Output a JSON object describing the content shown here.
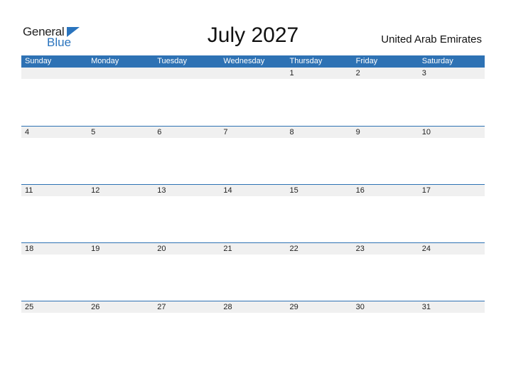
{
  "logo": {
    "general": "General",
    "blue": "Blue"
  },
  "title": "July 2027",
  "country": "United Arab Emirates",
  "colors": {
    "accent": "#2e72b4",
    "row_fill": "#f0f0f0",
    "logo_blue": "#2a74be"
  },
  "weekdays": [
    "Sunday",
    "Monday",
    "Tuesday",
    "Wednesday",
    "Thursday",
    "Friday",
    "Saturday"
  ],
  "weeks": [
    [
      "",
      "",
      "",
      "",
      "1",
      "2",
      "3"
    ],
    [
      "4",
      "5",
      "6",
      "7",
      "8",
      "9",
      "10"
    ],
    [
      "11",
      "12",
      "13",
      "14",
      "15",
      "16",
      "17"
    ],
    [
      "18",
      "19",
      "20",
      "21",
      "22",
      "23",
      "24"
    ],
    [
      "25",
      "26",
      "27",
      "28",
      "29",
      "30",
      "31"
    ]
  ]
}
